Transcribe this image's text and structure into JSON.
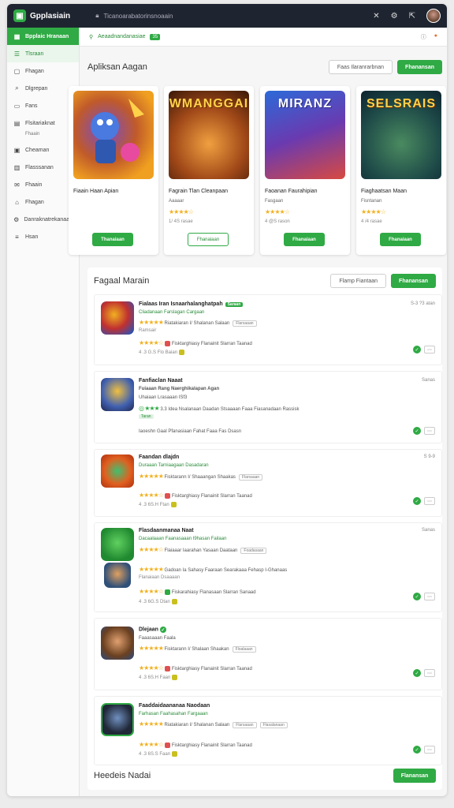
{
  "app": {
    "name": "Gpplasiain",
    "search_placeholder": "Ticanoarabatorinsnoaain"
  },
  "sidebar": {
    "items": [
      {
        "icon": "grid-icon",
        "label": "Bpplaic Hranaan"
      },
      {
        "icon": "list-icon",
        "label": "Tlsraan"
      },
      {
        "icon": "box-icon",
        "label": "Fhagan"
      },
      {
        "icon": "search-icon",
        "label": "Dlgrepan"
      },
      {
        "icon": "ticket-icon",
        "label": "Fans"
      },
      {
        "icon": "doc-icon",
        "label": "Flsitariaknat"
      },
      {
        "icon": "calendar-icon",
        "label": "Cheaman"
      },
      {
        "icon": "table-icon",
        "label": "Flasssanan"
      },
      {
        "icon": "mail-icon",
        "label": "Fhaain"
      },
      {
        "icon": "tag-icon",
        "label": "Fhagan"
      },
      {
        "icon": "settings-icon",
        "label": "Danraknatrekanaan"
      },
      {
        "icon": "menu-icon",
        "label": "Hsan"
      }
    ],
    "sub_label": "Fhaain"
  },
  "subbar": {
    "label": "Aeaadnandanasiae",
    "count": "35"
  },
  "featured": {
    "title": "Apliksan Aagan",
    "outline_button": "Faas Ilaranrarbnan",
    "green_button": "Fhanansan",
    "cards": [
      {
        "art_title": "",
        "name": "Fiaain Haan Apian",
        "publisher": "",
        "meta": "",
        "button": "Thanaiaan",
        "button_style": "green"
      },
      {
        "art_title": "WMANGGAI",
        "name": "Fagrain Tlan Cleanpaan",
        "publisher": "Aaaaar",
        "meta": "1/ 4S rasae",
        "button": "Fhanaiaan",
        "button_style": "outline"
      },
      {
        "art_title": "MIRANZ",
        "name": "Faoanan Faurahipian",
        "publisher": "Fasgaan",
        "meta": "4 @S rason",
        "button": "Fhanaiaan",
        "button_style": "green"
      },
      {
        "art_title": "SELSRAIS",
        "name": "Fiaghaatsan Maan",
        "publisher": "Fisntanan",
        "meta": "4 /4 rasae",
        "button": "Fhanaiaan",
        "button_style": "green"
      }
    ]
  },
  "recommended": {
    "title": "Fagaal Marain",
    "outline_button": "Flamp Fiantaan",
    "green_button": "Fhanansan",
    "footer_title": "Heedeis Nadai",
    "footer_button": "Flanansan",
    "rows": [
      {
        "title": "Fialaas Iran Isnaarhalanghatpah",
        "tag": "Saraan",
        "sub": "Cliadanaan Farslagan Cargaan",
        "line3": "Riatakiaran I/ Shalanan Salaan",
        "tag2": "Flarsaaan",
        "line4": "Ramsair",
        "line5": "Fisktarghiasy Flanainit Slarran Taanad",
        "meta": "4 .3 G.S Flo Baian",
        "right": "S-3 ?3 atan"
      },
      {
        "title": "Fanfiaclan Naaat",
        "sub": "Fuiaaan Rang Naerghikalapan Agan",
        "line3": "Uhaiaan Lrasaaan ISf3",
        "line4": "3.3 Idea Nsalanaan Daadan Stsaaaan Faaa Fiasanadaan Rassisk",
        "badge": "Taran",
        "line5": "Iaoeshn Gaal Pfanasiaan Fahat Faaa Fas Dsasn",
        "right": "Sanas"
      },
      {
        "title": "Faandan dlajdn",
        "sub": "Duraaan Tarniaagaan Dasadaran",
        "line3": "Fisktarann I/ Shaaangan Shaakas",
        "tag2": "Flarsaaan",
        "line5": "Fisktarghiasy Flanainit Slarran Taanad",
        "meta": "4 .3 6S.H Ftan",
        "right": "S 9-9"
      },
      {
        "title": "Flasdaanmanaa Naat",
        "sub": "Dacaalaaan Faanasaaan I9hasan Failaan",
        "line3": "Flaiaaar Iaarahan Yasaan Daataan",
        "tag2": "Foadasaan",
        "line4": "Gadoan Ia Sahasy Faaraan Searakaaa Fehasp I-Ghanaas",
        "line5": "Flanaiaan Dsaaaan",
        "line6": "Fiskarahiasy Flanasaan Slarran Sanaad",
        "meta": "4 .3 6G.S Dtan",
        "right": "Sanas"
      },
      {
        "title": "Dlejaan",
        "sub": "Faaasaaan Faala",
        "line3": "Fisktarann I/ Shalaan Shaakan",
        "tag2": "Floalaaan",
        "line5": "Fisktarghiasy Flanainit Slarran Taanad",
        "meta": "4 .3 6S.H Faan",
        "right": ""
      },
      {
        "title": "Faaddaidaananaa Naodaan",
        "sub": "Farhasan Faahasahan Fargaaan",
        "line3": "Riatakiaran I/ Shalanan Salaan",
        "tag2": "Flarsaaan",
        "tag3": "Flasalanaan",
        "line5": "Fisktarghiasy Flanainit Slarran Taanad",
        "meta": "4 .3 6S.S Faan",
        "right": ""
      }
    ]
  },
  "colors": {
    "accent": "#2faa44",
    "topbar": "#1f2530",
    "star": "#f2b01e"
  }
}
